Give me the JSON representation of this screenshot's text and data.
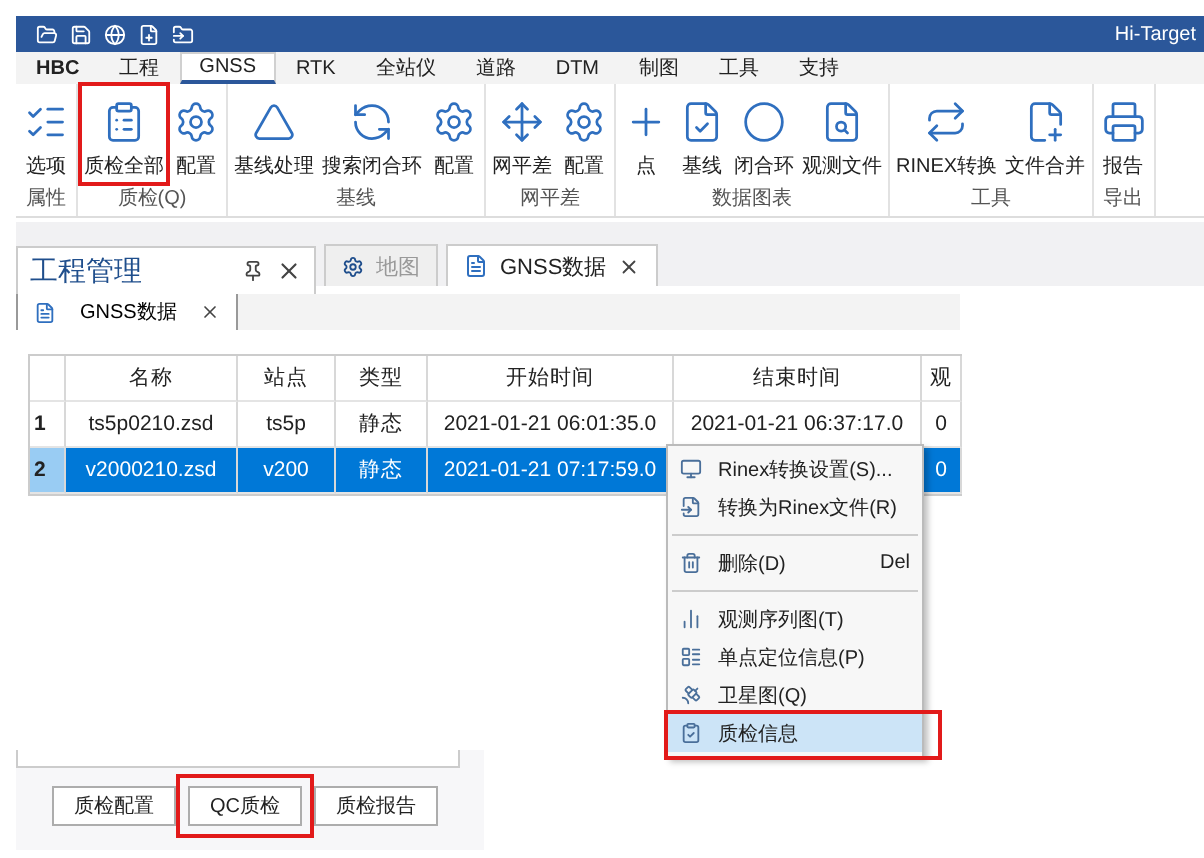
{
  "title_bar": {
    "title": "Hi-Target"
  },
  "ribbon_tabs": [
    {
      "label": "HBC",
      "selected": false
    },
    {
      "label": "工程",
      "selected": false
    },
    {
      "label": "GNSS",
      "selected": true
    },
    {
      "label": "RTK",
      "selected": false
    },
    {
      "label": "全站仪",
      "selected": false
    },
    {
      "label": "道路",
      "selected": false
    },
    {
      "label": "DTM",
      "selected": false
    },
    {
      "label": "制图",
      "selected": false
    },
    {
      "label": "工具",
      "selected": false
    },
    {
      "label": "支持",
      "selected": false
    }
  ],
  "ribbon_groups": [
    {
      "label": "属性",
      "buttons": [
        {
          "label": "选项",
          "highlighted": false
        }
      ]
    },
    {
      "label": "质检(Q)",
      "buttons": [
        {
          "label": "质检全部",
          "highlighted": true
        },
        {
          "label": "配置",
          "highlighted": false
        }
      ]
    },
    {
      "label": "基线",
      "buttons": [
        {
          "label": "基线处理",
          "highlighted": false
        },
        {
          "label": "搜索闭合环",
          "highlighted": false
        },
        {
          "label": "配置",
          "highlighted": false
        }
      ]
    },
    {
      "label": "网平差",
      "buttons": [
        {
          "label": "网平差",
          "highlighted": false
        },
        {
          "label": "配置",
          "highlighted": false
        }
      ]
    },
    {
      "label": "数据图表",
      "buttons": [
        {
          "label": "点",
          "highlighted": false
        },
        {
          "label": "基线",
          "highlighted": false
        },
        {
          "label": "闭合环",
          "highlighted": false
        },
        {
          "label": "观测文件",
          "highlighted": false
        }
      ]
    },
    {
      "label": "工具",
      "buttons": [
        {
          "label": "RINEX转换",
          "highlighted": false
        },
        {
          "label": "文件合并",
          "highlighted": false
        }
      ]
    },
    {
      "label": "导出",
      "buttons": [
        {
          "label": "报告",
          "highlighted": false
        }
      ]
    }
  ],
  "panel": {
    "title": "工程管理"
  },
  "doc_tabs": [
    {
      "label": "地图",
      "selected": false
    },
    {
      "label": "GNSS数据",
      "selected": true
    }
  ],
  "sub_tabs": [
    {
      "label": "GNSS数据",
      "selected": true
    }
  ],
  "table": {
    "columns": [
      "名称",
      "站点",
      "类型",
      "开始时间",
      "结束时间",
      "观"
    ],
    "rows": [
      {
        "index": "1",
        "selected": false,
        "cells": [
          "ts5p0210.zsd",
          "ts5p",
          "静态",
          "2021-01-21 06:01:35.0",
          "2021-01-21 06:37:17.0",
          "0"
        ]
      },
      {
        "index": "2",
        "selected": true,
        "cells": [
          "v2000210.zsd",
          "v200",
          "静态",
          "2021-01-21 07:17:59.0",
          null,
          "0"
        ]
      }
    ]
  },
  "context_menu": [
    {
      "kind": "item",
      "label": "Rinex转换设置(S)...",
      "highlighted": false
    },
    {
      "kind": "item",
      "label": "转换为Rinex文件(R)",
      "highlighted": false
    },
    {
      "kind": "separator"
    },
    {
      "kind": "item",
      "label": "删除(D)",
      "shortcut": "Del",
      "highlighted": false
    },
    {
      "kind": "separator"
    },
    {
      "kind": "item",
      "label": "观测序列图(T)",
      "highlighted": false
    },
    {
      "kind": "item",
      "label": "单点定位信息(P)",
      "highlighted": false
    },
    {
      "kind": "item",
      "label": "卫星图(Q)",
      "highlighted": false
    },
    {
      "kind": "item",
      "label": "质检信息",
      "highlighted": true
    }
  ],
  "qc_buttons": [
    {
      "label": "质检配置",
      "highlighted": false
    },
    {
      "label": "QC质检",
      "highlighted": true
    },
    {
      "label": "质检报告",
      "highlighted": false
    }
  ]
}
